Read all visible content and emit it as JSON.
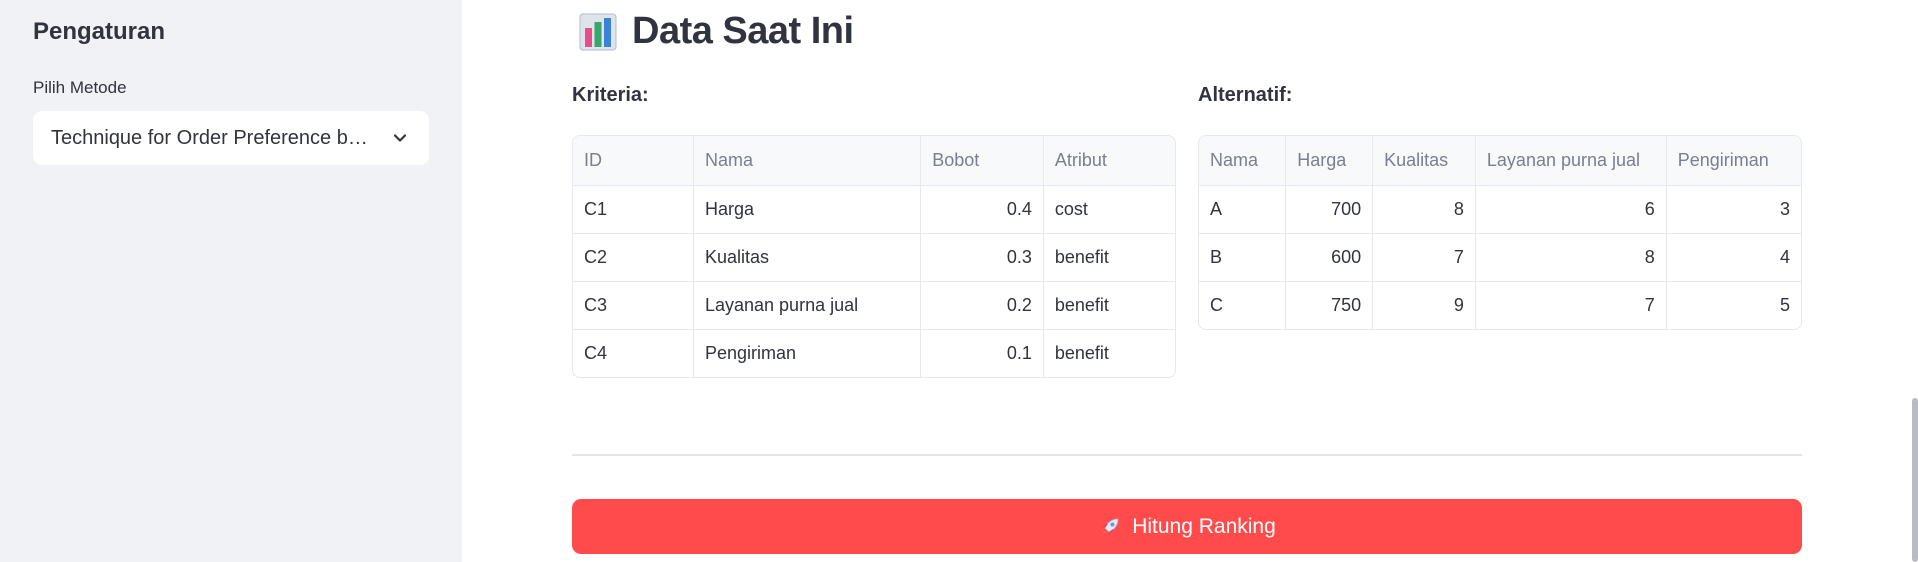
{
  "sidebar": {
    "title": "Pengaturan",
    "method_label": "Pilih Metode",
    "method_value": "Technique for Order Preference by Similarity to Ideal Solution (TOPSIS)"
  },
  "main": {
    "title": "Data Saat Ini",
    "title_icon": "bar-chart-icon",
    "kriteria": {
      "label": "Kriteria:",
      "headers": [
        "ID",
        "Nama",
        "Bobot",
        "Atribut"
      ],
      "rows": [
        [
          "C1",
          "Harga",
          "0.4",
          "cost"
        ],
        [
          "C2",
          "Kualitas",
          "0.3",
          "benefit"
        ],
        [
          "C3",
          "Layanan purna jual",
          "0.2",
          "benefit"
        ],
        [
          "C4",
          "Pengiriman",
          "0.1",
          "benefit"
        ]
      ]
    },
    "alternatif": {
      "label": "Alternatif:",
      "headers": [
        "Nama",
        "Harga",
        "Kualitas",
        "Layanan purna jual",
        "Pengiriman"
      ],
      "rows": [
        [
          "A",
          "700",
          "8",
          "6",
          "3"
        ],
        [
          "B",
          "600",
          "7",
          "8",
          "4"
        ],
        [
          "C",
          "750",
          "9",
          "7",
          "5"
        ]
      ]
    },
    "button_label": "Hitung Ranking",
    "button_icon": "rocket-icon"
  },
  "colors": {
    "sidebar_bg": "#f0f2f6",
    "primary": "#ff4b4b",
    "text": "#31333f"
  }
}
